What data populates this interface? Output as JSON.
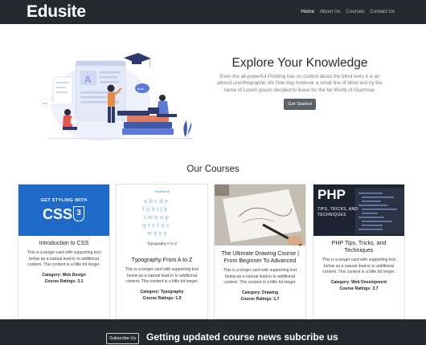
{
  "navbar": {
    "brand": "Edusite",
    "links": [
      "Home",
      "About Us",
      "Courses",
      "Contact Us"
    ]
  },
  "hero": {
    "title": "Explore Your Knowledge",
    "description": "Even the all-powerful Pointing has no control about the blind texts it is an almost unorthographic life One day however a small line of blind text by the name of Lorem Ipsum decided to leave for the far World of Grammar.",
    "button": "Get Started",
    "illustration_labels": [
      "Info",
      "Book"
    ]
  },
  "courses": {
    "title": "Our Courses",
    "category_label": "Category:",
    "rating_label": "Course Ratings:",
    "items": [
      {
        "title": "Introduction to CSS",
        "text": "This is a longer card with supporting text below as a natural lead-in to additional content. This content is a little bit longer.",
        "category": "Web Design",
        "rating": "3.1",
        "image_top": "GET STYLING WITH",
        "image_main": "CSS",
        "image_badge": "3"
      },
      {
        "title": "Typography From A to Z",
        "text": "This is a longer card with supporting text below as a natural lead-in to additional content. This content is a little bit longer.",
        "category": "Typography",
        "rating": "1.9",
        "image_top": "YouthWork",
        "image_caption": "Typography A to Z"
      },
      {
        "title": "The Ultimate Drawing Course | From Beginner To Advanced",
        "text": "This is a longer card with supporting text below as a natural lead-in to additional content. This content is a little bit longer.",
        "category": "Drawing",
        "rating": "1.7"
      },
      {
        "title": "PHP Tips, Tricks, and Techniques",
        "text": "This is a longer card with supporting text below as a natural lead-in to additional content. This content is a little bit longer.",
        "category": "Web Development",
        "rating": "2.7",
        "image_main": "PHP",
        "image_sub": "TIPS, TRICKS, AND TECHNIQUES"
      }
    ]
  },
  "footer": {
    "button": "Subscribe Us",
    "text": "Getting updated course news subcribe us"
  },
  "colors": {
    "navbar_bg": "#252a2f",
    "button_bg": "#5c6167",
    "css_banner": "#1f69c8",
    "php_banner": "#1d2330"
  }
}
